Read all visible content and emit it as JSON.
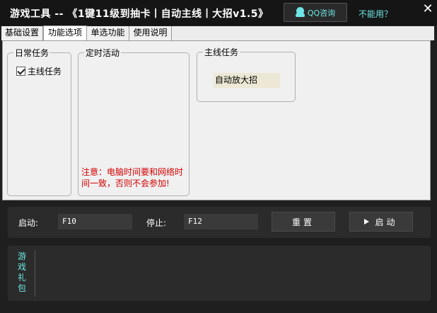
{
  "titlebar": {
    "title": "游戏工具 -- 《1键11级到抽卡丨自动主线丨大招v1.5》",
    "qq_button": "QQ咨询",
    "help_link": "不能用？",
    "close": "✕"
  },
  "tabs": [
    {
      "label": "基础设置",
      "active": false
    },
    {
      "label": "功能选项",
      "active": true
    },
    {
      "label": "单选功能",
      "active": false
    },
    {
      "label": "使用说明",
      "active": false
    }
  ],
  "daily": {
    "title": "日常任务",
    "main_task_checkbox": {
      "label": "主线任务",
      "checked": true
    }
  },
  "timed": {
    "title": "定时活动",
    "notice": "注意：电脑时间要和网络时间一致，否则不会参加!"
  },
  "main_tasks": {
    "title": "主线任务",
    "item": "自动放大招"
  },
  "hotkeys": {
    "start_label": "启动:",
    "start_value": "F10",
    "stop_label": "停止:",
    "stop_value": "F12",
    "reset_button": "重置",
    "start_button": "启动"
  },
  "gifts": {
    "label": "游戏礼包"
  },
  "colors": {
    "accent": "#6ee6e6",
    "notice": "#d40000"
  }
}
